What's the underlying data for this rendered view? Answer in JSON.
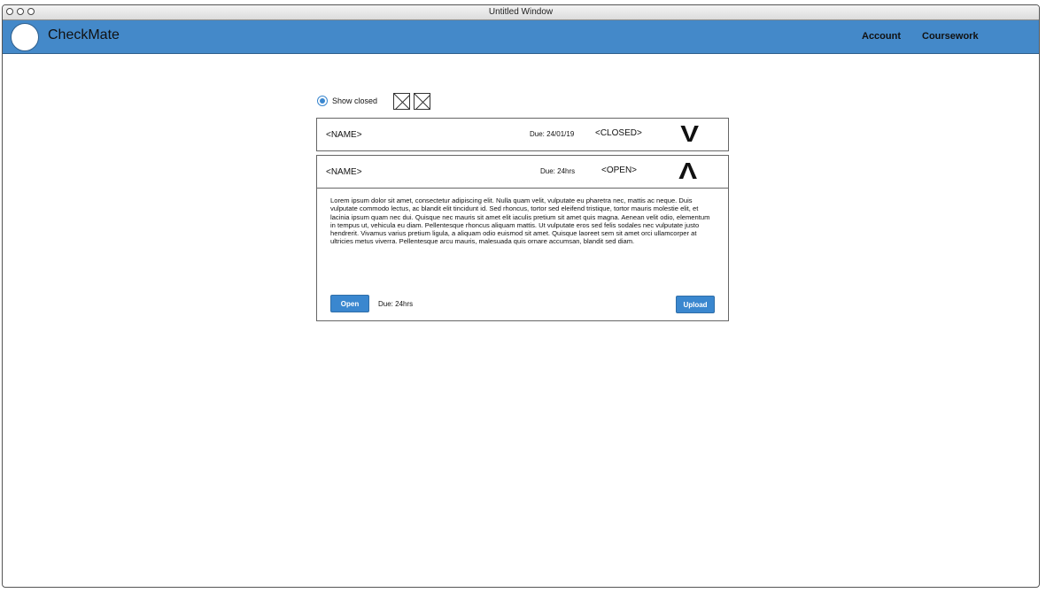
{
  "window": {
    "title": "Untitled Window"
  },
  "header": {
    "app_name": "CheckMate",
    "nav": {
      "account": "Account",
      "coursework": "Coursework"
    }
  },
  "filter": {
    "show_closed_label": "Show closed"
  },
  "assignments": [
    {
      "name": "<NAME>",
      "due": "Due: 24/01/19",
      "status": "<CLOSED>",
      "toggle": "V"
    },
    {
      "name": "<NAME>",
      "due": "Due: 24hrs",
      "status": "<OPEN>",
      "toggle": "Λ",
      "description": "Lorem ipsum dolor sit amet, consectetur adipiscing elit. Nulla quam velit, vulputate eu pharetra nec, mattis ac neque. Duis vulputate commodo lectus, ac blandit elit tincidunt id. Sed rhoncus, tortor sed eleifend tristique, tortor mauris molestie elit, et lacinia ipsum quam nec dui. Quisque nec mauris sit amet elit iaculis pretium sit amet quis magna. Aenean velit odio, elementum in tempus ut, vehicula eu diam. Pellentesque rhoncus aliquam mattis. Ut vulputate eros sed felis sodales nec vulputate justo hendrerit. Vivamus varius pretium ligula, a aliquam odio euismod sit amet. Quisque laoreet sem sit amet orci ullamcorper at ultricies metus viverra. Pellentesque arcu mauris, malesuada quis ornare accumsan, blandit sed diam.",
      "open_label": "Open",
      "body_due": "Due: 24hrs",
      "upload_label": "Upload"
    }
  ],
  "colors": {
    "app_bar": "#4489c9",
    "button": "#3a87cf"
  }
}
